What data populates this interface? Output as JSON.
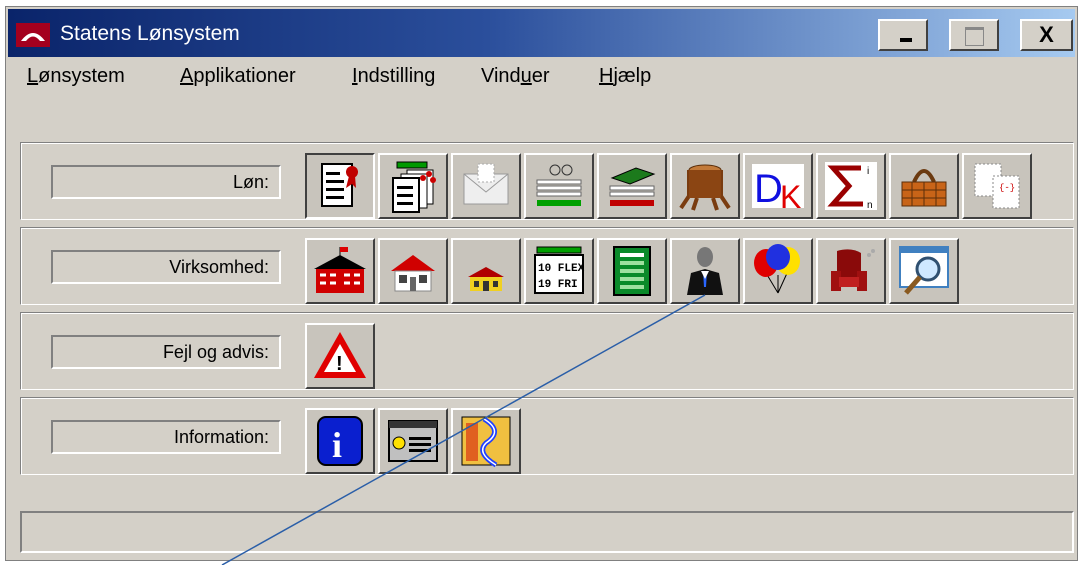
{
  "window": {
    "title": "Statens Lønsystem"
  },
  "titlebar_buttons": {
    "minimize": "_",
    "maximize": "□",
    "close": "X"
  },
  "menu": [
    {
      "pre": "",
      "acc": "L",
      "post": "ønsystem"
    },
    {
      "pre": "",
      "acc": "A",
      "post": "pplikationer"
    },
    {
      "pre": "",
      "acc": "I",
      "post": "ndstilling"
    },
    {
      "pre": "Vind",
      "acc": "u",
      "post": "er"
    },
    {
      "pre": "",
      "acc": "H",
      "post": "jælp"
    }
  ],
  "groups": [
    {
      "label": "Løn:",
      "icons": [
        "document-ribbon-icon",
        "document-stack-icon",
        "envelope-icon",
        "glasses-papers-icon",
        "green-book-stack-icon",
        "tree-stump-icon",
        "dk-letters-icon",
        "sigma-icon",
        "picnic-basket-icon",
        "dotted-cards-icon"
      ]
    },
    {
      "label": "Virksomhed:",
      "icons": [
        "red-mansion-flag-icon",
        "red-house-icon",
        "yellow-house-icon",
        "flex-calendar-icon",
        "green-ledger-icon",
        "person-suit-icon",
        "balloons-icon",
        "armchair-icon",
        "magnifier-window-icon"
      ]
    },
    {
      "label": "Fejl og advis:",
      "icons": [
        "warning-triangle-icon"
      ]
    },
    {
      "label": "Information:",
      "icons": [
        "info-icon",
        "message-window-icon",
        "map-icon"
      ]
    }
  ],
  "icon_text": {
    "flex_line1": "10 FLEX",
    "flex_line2": "19 FRI",
    "dk": "DK",
    "info": "i",
    "warning": "!"
  },
  "status": {
    "text": ""
  }
}
